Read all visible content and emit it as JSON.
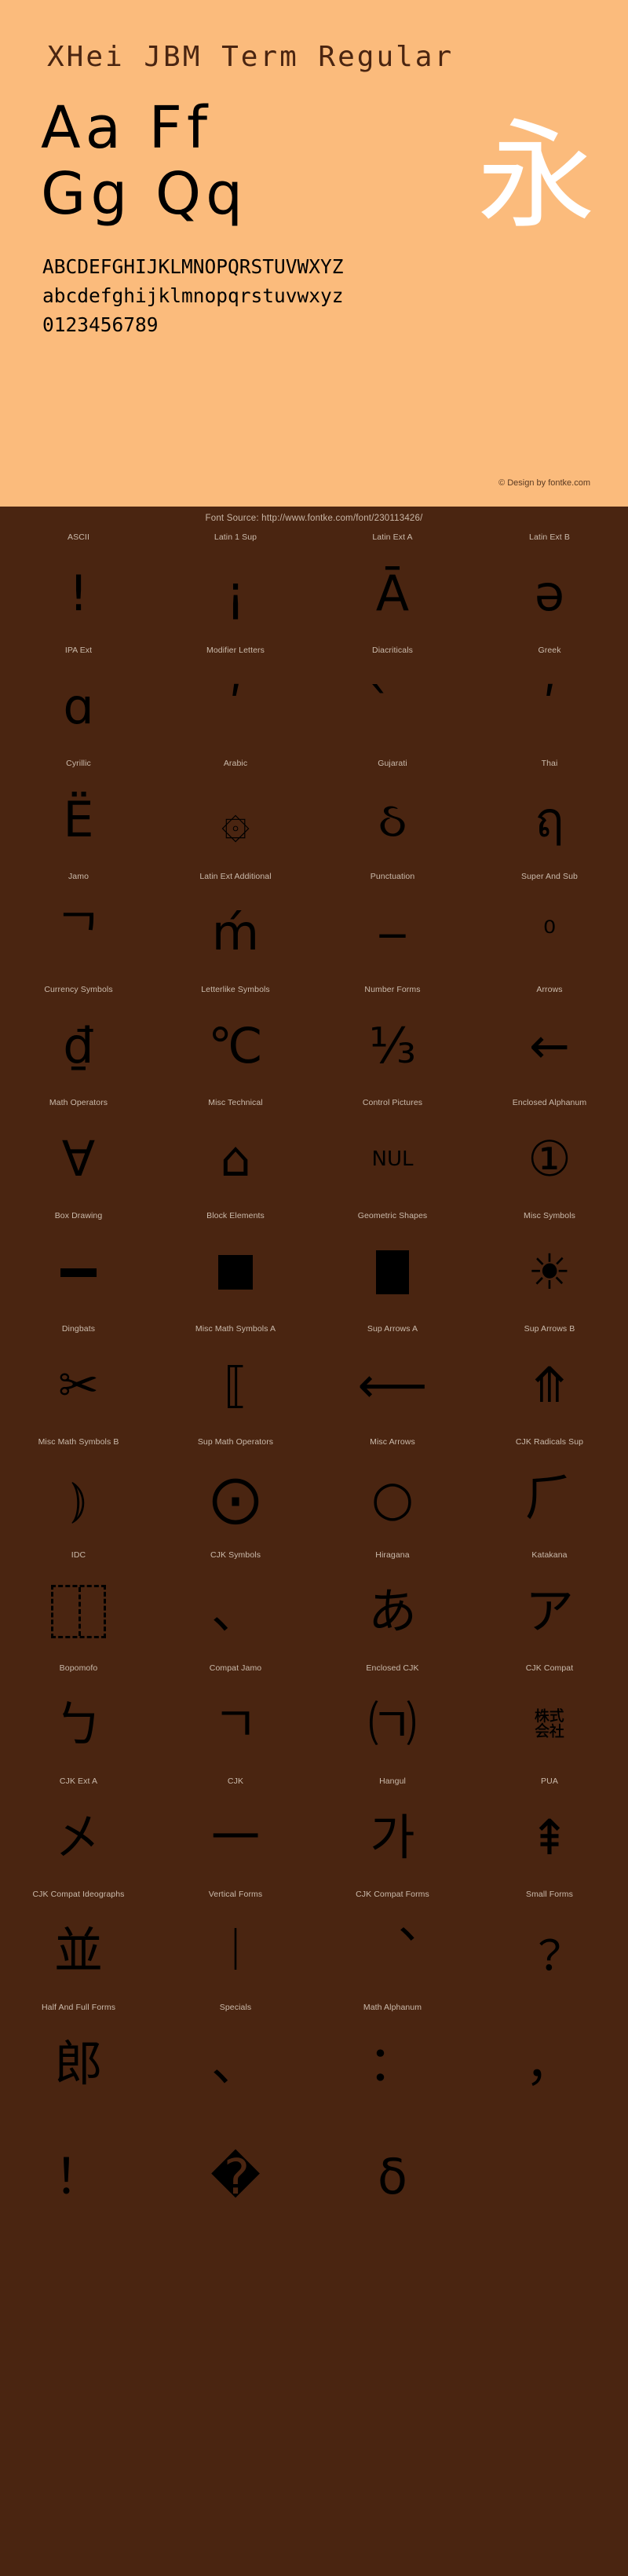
{
  "hero": {
    "font_title": "XHei JBM Term Regular",
    "sample_big_1": "Aa  Ff",
    "sample_big_2": "Gg  Qq",
    "sample_cjk": "永",
    "uppercase": "ABCDEFGHIJKLMNOPQRSTUVWXYZ",
    "lowercase": "abcdefghijklmnopqrstuvwxyz",
    "digits": "0123456789",
    "credit": "© Design by fontke.com",
    "background_color": "#fbbb7c",
    "text_color": "#000000",
    "cjk_color": "#ffffff"
  },
  "source": {
    "text": "Font Source: http://www.fontke.com/font/230113426/",
    "background_color": "#4a2511",
    "text_color": "#c9b6a6"
  },
  "grid": {
    "columns": 4,
    "label_color": "#cbbbac",
    "glyph_color": "#000000",
    "background_color": "#4a2511",
    "cells": [
      {
        "label": "ASCII",
        "glyph": "!",
        "style": ""
      },
      {
        "label": "Latin 1 Sup",
        "glyph": "¡",
        "style": ""
      },
      {
        "label": "Latin Ext A",
        "glyph": "Ā",
        "style": ""
      },
      {
        "label": "Latin Ext B",
        "glyph": "ə",
        "style": ""
      },
      {
        "label": "IPA Ext",
        "glyph": "ɑ",
        "style": ""
      },
      {
        "label": "Modifier Letters",
        "glyph": "ʹ",
        "style": ""
      },
      {
        "label": "Diacriticals",
        "glyph": "̀",
        "style": ""
      },
      {
        "label": "Greek",
        "glyph": "ʹ",
        "style": ""
      },
      {
        "label": "Cyrillic",
        "glyph": "Ё",
        "style": ""
      },
      {
        "label": "Arabic",
        "glyph": "۞",
        "style": ""
      },
      {
        "label": "Gujarati",
        "glyph": "ઠ",
        "style": ""
      },
      {
        "label": "Thai",
        "glyph": "ฤ",
        "style": ""
      },
      {
        "label": "Jamo",
        "glyph": "ᄀ",
        "style": ""
      },
      {
        "label": "Latin Ext Additional",
        "glyph": "ḿ",
        "style": ""
      },
      {
        "label": "Punctuation",
        "glyph": "‒",
        "style": ""
      },
      {
        "label": "Super And Sub",
        "glyph": "⁰",
        "style": "small"
      },
      {
        "label": "Currency Symbols",
        "glyph": "₫",
        "style": ""
      },
      {
        "label": "Letterlike Symbols",
        "glyph": "℃",
        "style": ""
      },
      {
        "label": "Number Forms",
        "glyph": "⅓",
        "style": ""
      },
      {
        "label": "Arrows",
        "glyph": "←",
        "style": ""
      },
      {
        "label": "Math Operators",
        "glyph": "∀",
        "style": ""
      },
      {
        "label": "Misc Technical",
        "glyph": "⌂",
        "style": ""
      },
      {
        "label": "Control Pictures",
        "glyph": "NUL",
        "style": "tiny"
      },
      {
        "label": "Enclosed Alphanum",
        "glyph": "①",
        "style": ""
      },
      {
        "label": "Box Drawing",
        "glyph": "─",
        "style": "shape-bar"
      },
      {
        "label": "Block Elements",
        "glyph": "█",
        "style": "shape-square-filled"
      },
      {
        "label": "Geometric Shapes",
        "glyph": "■",
        "style": "shape-square-tall"
      },
      {
        "label": "Misc Symbols",
        "glyph": "☀",
        "style": ""
      },
      {
        "label": "Dingbats",
        "glyph": "✂",
        "style": ""
      },
      {
        "label": "Misc Math Symbols A",
        "glyph": "⟦",
        "style": ""
      },
      {
        "label": "Sup Arrows A",
        "glyph": "⟵",
        "style": ""
      },
      {
        "label": "Sup Arrows B",
        "glyph": "⤊",
        "style": ""
      },
      {
        "label": "Misc Math Symbols B",
        "glyph": "⦆",
        "style": ""
      },
      {
        "label": "Sup Math Operators",
        "glyph": "⨀",
        "style": ""
      },
      {
        "label": "Misc Arrows",
        "glyph": "○",
        "style": ""
      },
      {
        "label": "CJK Radicals Sup",
        "glyph": "⺁",
        "style": ""
      },
      {
        "label": "IDC",
        "glyph": "⿰",
        "style": "shape-dashed-box"
      },
      {
        "label": "CJK Symbols",
        "glyph": "、",
        "style": ""
      },
      {
        "label": "Hiragana",
        "glyph": "あ",
        "style": ""
      },
      {
        "label": "Katakana",
        "glyph": "ア",
        "style": ""
      },
      {
        "label": "Bopomofo",
        "glyph": "ㄅ",
        "style": ""
      },
      {
        "label": "Compat Jamo",
        "glyph": "ㄱ",
        "style": ""
      },
      {
        "label": "Enclosed CJK",
        "glyph": "㈀",
        "style": ""
      },
      {
        "label": "CJK Compat",
        "glyph": "㍿",
        "style": "cjk2"
      },
      {
        "label": "CJK Ext A",
        "glyph": "㐅",
        "style": ""
      },
      {
        "label": "CJK",
        "glyph": "一",
        "style": ""
      },
      {
        "label": "Hangul",
        "glyph": "가",
        "style": ""
      },
      {
        "label": "PUA",
        "glyph": "⇞",
        "style": ""
      },
      {
        "label": "CJK Compat Ideographs",
        "glyph": "並",
        "style": ""
      },
      {
        "label": "Vertical Forms",
        "glyph": "︱",
        "style": ""
      },
      {
        "label": "CJK Compat Forms",
        "glyph": "︑",
        "style": ""
      },
      {
        "label": "Small Forms",
        "glyph": "﹖",
        "style": ""
      },
      {
        "label": "Half And Full Forms",
        "glyph": "郎",
        "style": ""
      },
      {
        "label": "Specials",
        "glyph": "、",
        "style": ""
      },
      {
        "label": "Math Alphanum",
        "glyph": "：",
        "style": ""
      },
      {
        "label": "",
        "glyph": "，",
        "style": ""
      },
      {
        "label": "",
        "glyph": "！",
        "style": ""
      },
      {
        "label": "",
        "glyph": "�",
        "style": ""
      },
      {
        "label": "",
        "glyph": "ẟ",
        "style": ""
      },
      {
        "label": "",
        "glyph": "",
        "style": ""
      }
    ]
  }
}
